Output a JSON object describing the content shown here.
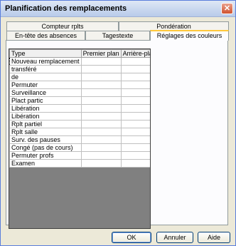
{
  "window": {
    "title": "Planification des remplacements",
    "close_label": "✕"
  },
  "tabs_row1": [
    {
      "label": "Compteur rplts"
    },
    {
      "label": "Pondération"
    }
  ],
  "tabs_row2": [
    {
      "label": "En-tête des absences"
    },
    {
      "label": "Tagestexte"
    },
    {
      "label": "Réglages des couleurs",
      "active": true
    }
  ],
  "grid": {
    "columns": [
      "Type",
      "Premier plan",
      "Arrière-plan"
    ],
    "rows": [
      "Nouveau remplacement",
      "transféré",
      "de",
      "Permuter",
      "Surveillance",
      "Plact partic",
      "Libération",
      "Libération",
      "Rplt partiel",
      "Rplt salle",
      "Surv. des pauses",
      "Congé (pas de cours)",
      "Permuter profs",
      "Examen"
    ]
  },
  "buttons": {
    "ok": "OK",
    "cancel": "Annuler",
    "help": "Aide"
  }
}
